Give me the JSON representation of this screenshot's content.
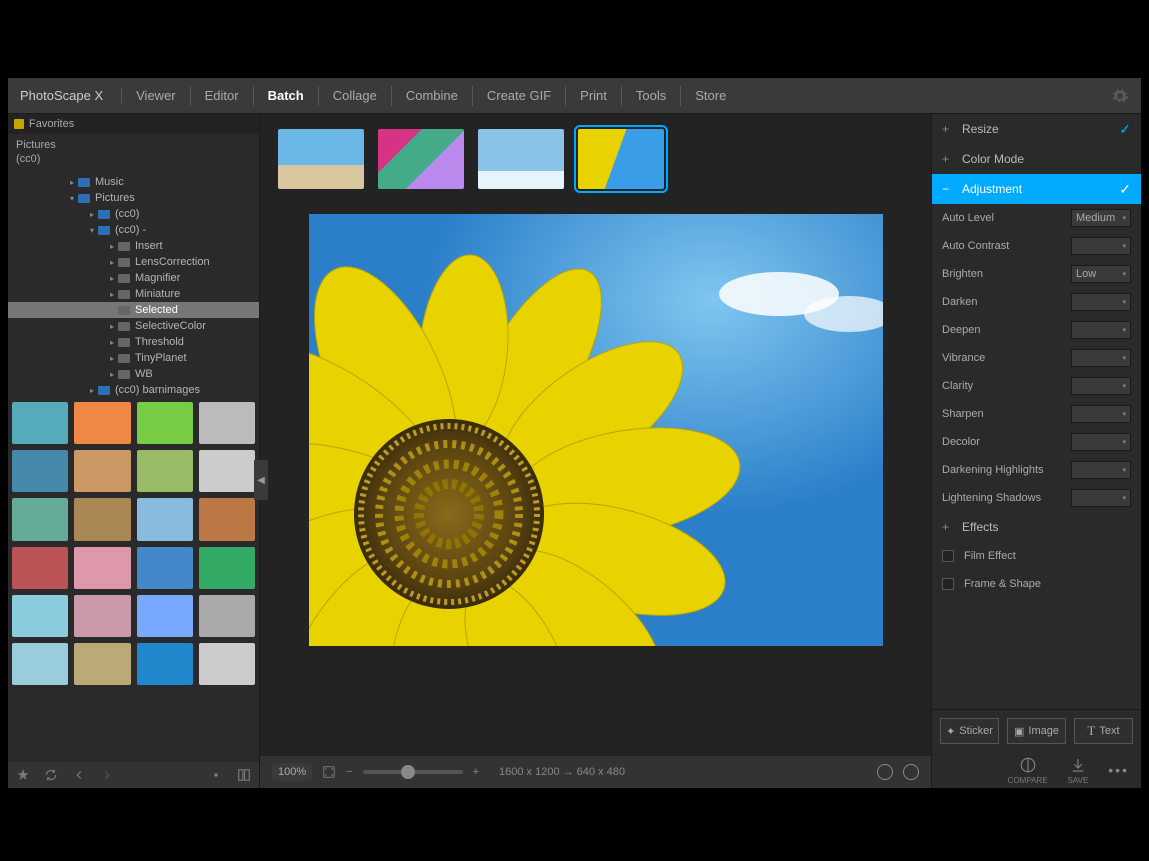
{
  "brand": "PhotoScape X",
  "tabs": [
    "Viewer",
    "Editor",
    "Batch",
    "Collage",
    "Combine",
    "Create GIF",
    "Print",
    "Tools",
    "Store"
  ],
  "active_tab": "Batch",
  "favorites_label": "Favorites",
  "breadcrumb": [
    "Pictures",
    "(cc0)"
  ],
  "tree": [
    {
      "label": "Music",
      "ind": 60,
      "arrow": "▸",
      "grey": false
    },
    {
      "label": "Pictures",
      "ind": 60,
      "arrow": "▾",
      "grey": false
    },
    {
      "label": "(cc0)",
      "ind": 80,
      "arrow": "▸",
      "grey": false
    },
    {
      "label": "(cc0) -",
      "ind": 80,
      "arrow": "▾",
      "grey": false
    },
    {
      "label": "Insert",
      "ind": 100,
      "arrow": "▸",
      "grey": true
    },
    {
      "label": "LensCorrection",
      "ind": 100,
      "arrow": "▸",
      "grey": true
    },
    {
      "label": "Magnifier",
      "ind": 100,
      "arrow": "▸",
      "grey": true
    },
    {
      "label": "Miniature",
      "ind": 100,
      "arrow": "▸",
      "grey": true
    },
    {
      "label": "Selected",
      "ind": 100,
      "arrow": "",
      "grey": true,
      "sel": true
    },
    {
      "label": "SelectiveColor",
      "ind": 100,
      "arrow": "▸",
      "grey": true
    },
    {
      "label": "Threshold",
      "ind": 100,
      "arrow": "▸",
      "grey": true
    },
    {
      "label": "TinyPlanet",
      "ind": 100,
      "arrow": "▸",
      "grey": true
    },
    {
      "label": "WB",
      "ind": 100,
      "arrow": "▸",
      "grey": true
    },
    {
      "label": "(cc0) barnimages",
      "ind": 80,
      "arrow": "▸",
      "grey": false
    }
  ],
  "zoom_label": "100%",
  "dimensions": "1600 x 1200 → 640 x 480",
  "panel": {
    "resize": "Resize",
    "color_mode": "Color Mode",
    "adjustment": "Adjustment",
    "effects": "Effects",
    "film": "Film Effect",
    "frame": "Frame & Shape"
  },
  "adjustments": [
    {
      "label": "Auto Level",
      "value": "Medium"
    },
    {
      "label": "Auto Contrast",
      "value": ""
    },
    {
      "label": "Brighten",
      "value": "Low"
    },
    {
      "label": "Darken",
      "value": ""
    },
    {
      "label": "Deepen",
      "value": ""
    },
    {
      "label": "Vibrance",
      "value": ""
    },
    {
      "label": "Clarity",
      "value": ""
    },
    {
      "label": "Sharpen",
      "value": ""
    },
    {
      "label": "Decolor",
      "value": ""
    },
    {
      "label": "Darkening Highlights",
      "value": ""
    },
    {
      "label": "Lightening Shadows",
      "value": ""
    }
  ],
  "tools": {
    "sticker": "Sticker",
    "image": "Image",
    "text": "Text"
  },
  "footer": {
    "compare": "COMPARE",
    "save": "SAVE"
  }
}
